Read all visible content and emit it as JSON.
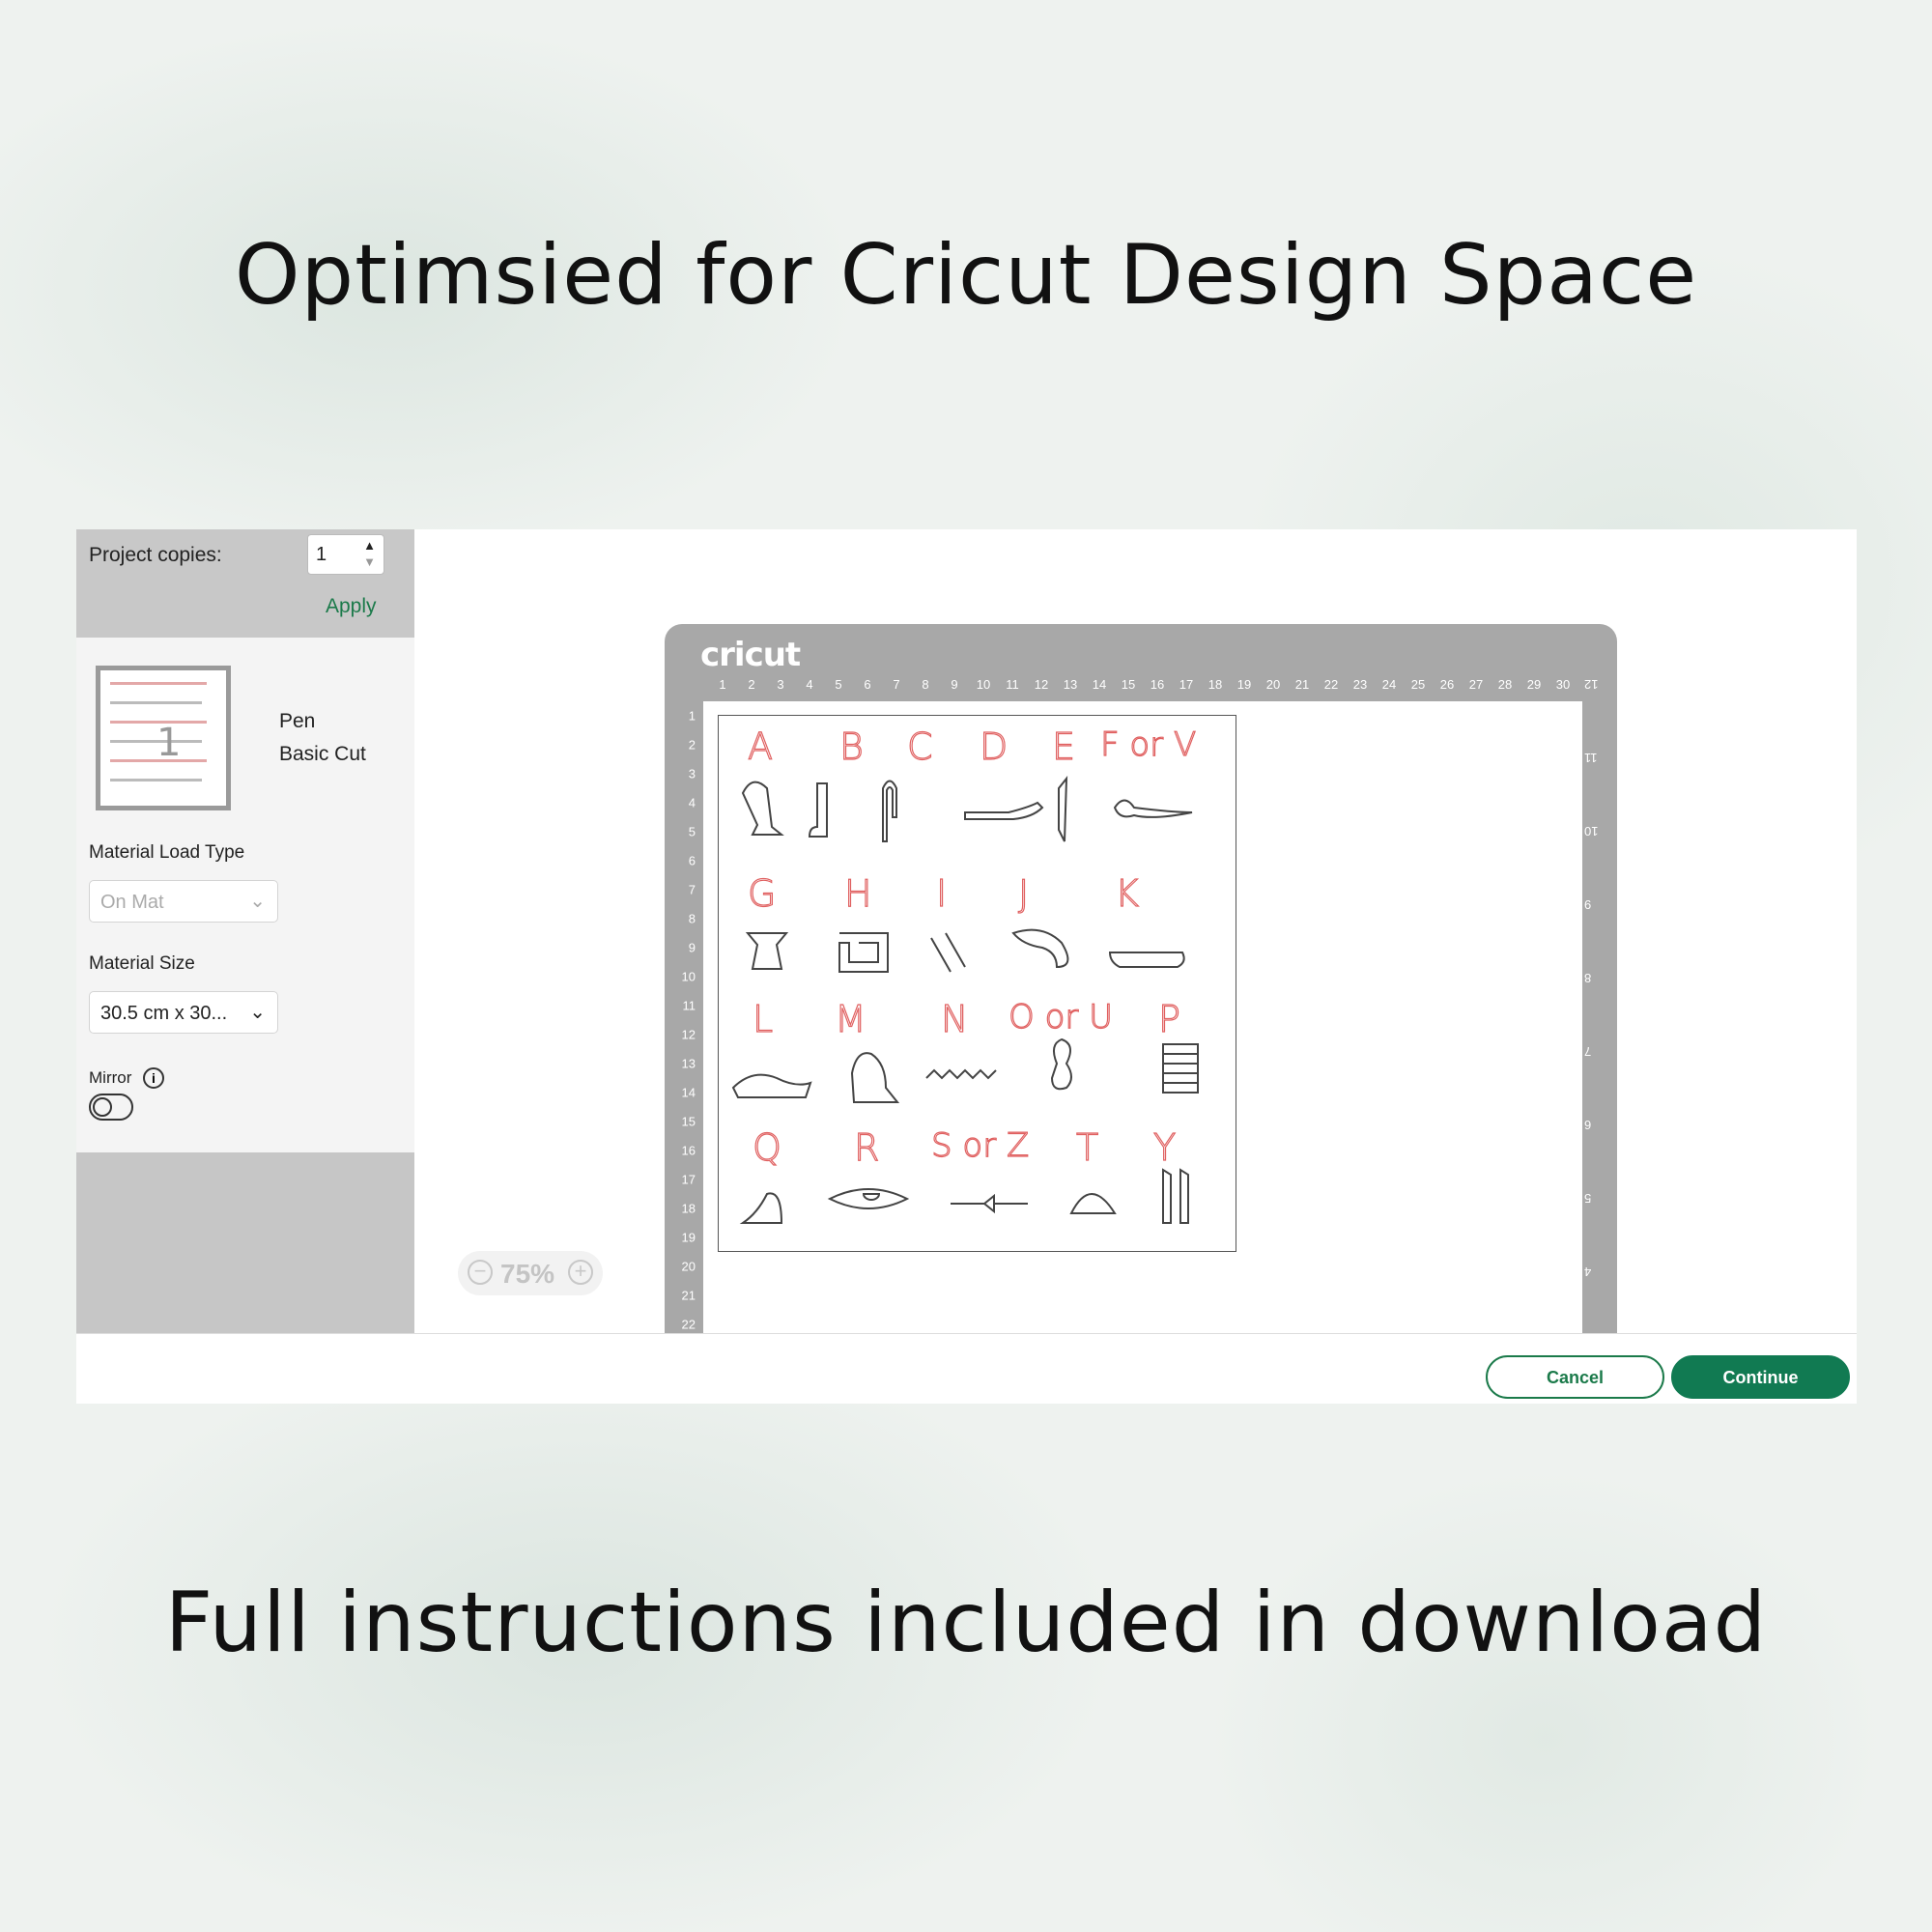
{
  "headlines": {
    "top": "Optimsied for Cricut Design Space",
    "bottom": "Full instructions included in download"
  },
  "sidebar": {
    "project_copies_label": "Project copies:",
    "project_copies_value": "1",
    "apply_label": "Apply",
    "mat_tool": "Pen",
    "mat_cut_type": "Basic Cut",
    "material_load_type_label": "Material Load Type",
    "material_load_type_value": "On Mat",
    "material_size_label": "Material Size",
    "material_size_value": "30.5 cm x 30...",
    "mirror_label": "Mirror",
    "mirror_on": false,
    "thumbnail_number": "1"
  },
  "mat": {
    "brand": "cricut",
    "ruler_top": [
      "1",
      "2",
      "3",
      "4",
      "5",
      "6",
      "7",
      "8",
      "9",
      "10",
      "11",
      "12",
      "13",
      "14",
      "15",
      "16",
      "17",
      "18",
      "19",
      "20",
      "21",
      "22",
      "23",
      "24",
      "25",
      "26",
      "27",
      "28",
      "29",
      "30"
    ],
    "ruler_left": [
      "1",
      "2",
      "3",
      "4",
      "5",
      "6",
      "7",
      "8",
      "9",
      "10",
      "11",
      "12",
      "13",
      "14",
      "15",
      "16",
      "17",
      "18",
      "19",
      "20",
      "21",
      "22"
    ],
    "ruler_right": [
      "12",
      "11",
      "10",
      "9",
      "8",
      "7",
      "6",
      "5",
      "4"
    ],
    "design_labels": [
      "A",
      "B",
      "C",
      "D",
      "E",
      "F or V",
      "G",
      "H",
      "I",
      "J",
      "K",
      "L",
      "M",
      "N",
      "O or U",
      "P",
      "Q",
      "R",
      "S or Z",
      "T",
      "Y"
    ],
    "label_color": "#e06060"
  },
  "zoom": {
    "value": "75%"
  },
  "footer": {
    "cancel_label": "Cancel",
    "continue_label": "Continue",
    "accent": "#117a52"
  }
}
